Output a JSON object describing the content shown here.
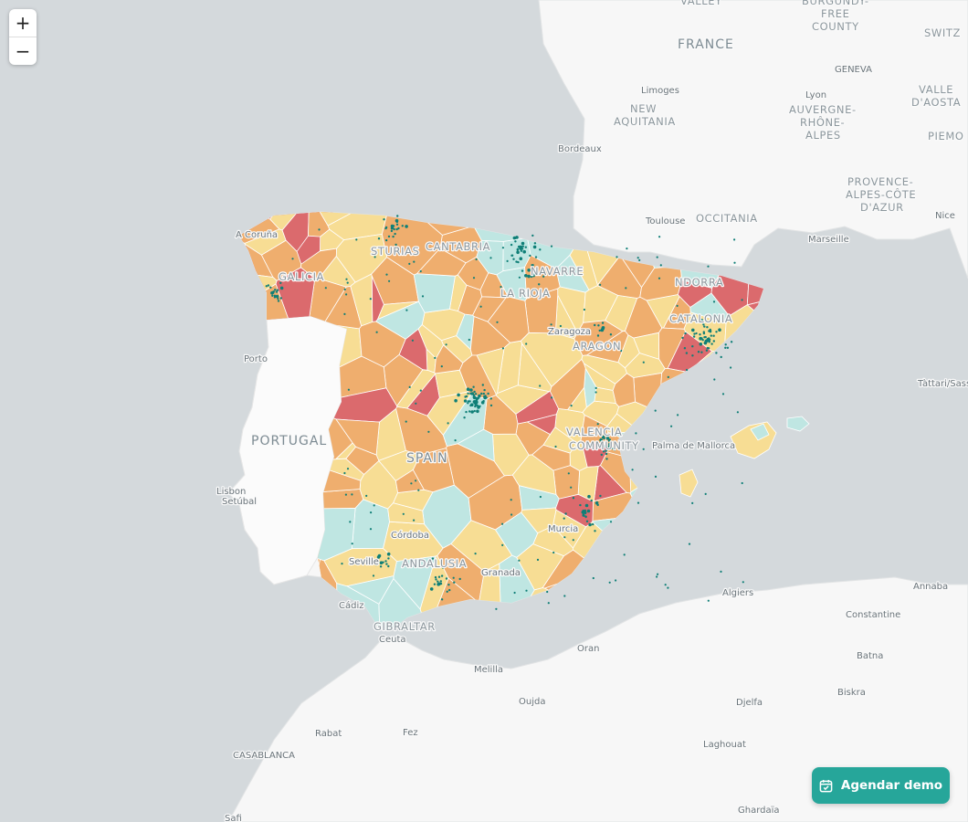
{
  "zoom": {
    "in_label": "+",
    "out_label": "−"
  },
  "cta": {
    "label": "Agendar demo",
    "icon": "calendar-icon",
    "color": "#26a69a"
  },
  "palette": {
    "low": "#bfe6e2",
    "mid_low": "#f7dd94",
    "mid_high": "#efae6e",
    "high": "#db6a6d",
    "points": "#0f7f77"
  },
  "labels": {
    "countries": [
      {
        "id": "france",
        "text": "FRANCE"
      },
      {
        "id": "portugal",
        "text": "PORTUGAL"
      },
      {
        "id": "spain",
        "text": "SPAIN"
      }
    ],
    "regions": [
      {
        "id": "valley",
        "text": "VALLEY"
      },
      {
        "id": "burgundy-1",
        "text": "BURGUNDY-"
      },
      {
        "id": "burgundy-2",
        "text": "FREE"
      },
      {
        "id": "burgundy-3",
        "text": "COUNTY"
      },
      {
        "id": "switz",
        "text": "SWITZ"
      },
      {
        "id": "new-aq-1",
        "text": "NEW"
      },
      {
        "id": "new-aq-2",
        "text": "AQUITANIA"
      },
      {
        "id": "auv-1",
        "text": "AUVERGNE-"
      },
      {
        "id": "auv-2",
        "text": "RHÔNE-"
      },
      {
        "id": "auv-3",
        "text": "ALPES"
      },
      {
        "id": "aosta-1",
        "text": "VALLE"
      },
      {
        "id": "aosta-2",
        "text": "D'AOSTA"
      },
      {
        "id": "piemo",
        "text": "PIEMO"
      },
      {
        "id": "occitania",
        "text": "OCCITANIA"
      },
      {
        "id": "prov-1",
        "text": "PROVENCE-"
      },
      {
        "id": "prov-2",
        "text": "ALPES-CÔTE"
      },
      {
        "id": "prov-3",
        "text": "D'AZUR"
      },
      {
        "id": "andorra",
        "text": "NDORRA"
      },
      {
        "id": "asturias",
        "text": "STURIAS"
      },
      {
        "id": "cantabria",
        "text": "CANTABRIA"
      },
      {
        "id": "navarre",
        "text": "NAVARRE"
      },
      {
        "id": "larioja",
        "text": "LA RIOJA"
      },
      {
        "id": "aragon",
        "text": "ARAGON"
      },
      {
        "id": "catalonia",
        "text": "CATALONIA"
      },
      {
        "id": "valencia-1",
        "text": "VALENCIA"
      },
      {
        "id": "valencia-2",
        "text": "COMMUNITY"
      },
      {
        "id": "andalusia",
        "text": "ANDALUSIA"
      },
      {
        "id": "gibraltar",
        "text": "GIBRALTAR"
      },
      {
        "id": "galicia",
        "text": "GALICIA"
      }
    ],
    "cities": [
      {
        "id": "geneva",
        "text": "GENEVA"
      },
      {
        "id": "limoges",
        "text": "Limoges"
      },
      {
        "id": "lyon",
        "text": "Lyon"
      },
      {
        "id": "bordeaux",
        "text": "Bordeaux"
      },
      {
        "id": "toulouse",
        "text": "Toulouse"
      },
      {
        "id": "marseille",
        "text": "Marseille"
      },
      {
        "id": "nice",
        "text": "Nice"
      },
      {
        "id": "acoruna",
        "text": "A Coruña"
      },
      {
        "id": "porto",
        "text": "Porto"
      },
      {
        "id": "zaragoza",
        "text": "Zaragoza"
      },
      {
        "id": "tattari",
        "text": "Tàttari/Sass"
      },
      {
        "id": "palma",
        "text": "Palma de Mallorca"
      },
      {
        "id": "lisbon",
        "text": "Lisbon"
      },
      {
        "id": "setubal",
        "text": "Setúbal"
      },
      {
        "id": "cordoba",
        "text": "Córdoba"
      },
      {
        "id": "murcia",
        "text": "Murcia"
      },
      {
        "id": "sevilla",
        "text": "Seville"
      },
      {
        "id": "granada",
        "text": "Granada"
      },
      {
        "id": "cadiz",
        "text": "Cádiz"
      },
      {
        "id": "ceuta",
        "text": "Ceuta"
      },
      {
        "id": "algiers",
        "text": "Algiers"
      },
      {
        "id": "annaba",
        "text": "Annaba"
      },
      {
        "id": "constantine",
        "text": "Constantine"
      },
      {
        "id": "oran",
        "text": "Oran"
      },
      {
        "id": "melilla",
        "text": "Melilla"
      },
      {
        "id": "batna",
        "text": "Batna"
      },
      {
        "id": "oujda",
        "text": "Oujda"
      },
      {
        "id": "djelfa",
        "text": "Djelfa"
      },
      {
        "id": "biskra",
        "text": "Biskra"
      },
      {
        "id": "rabat",
        "text": "Rabat"
      },
      {
        "id": "fez",
        "text": "Fez"
      },
      {
        "id": "casablanca",
        "text": "CASABLANCA"
      },
      {
        "id": "laghouat",
        "text": "Laghouat"
      },
      {
        "id": "ghardaia",
        "text": "Ghardaïa"
      },
      {
        "id": "safi",
        "text": "Safi"
      }
    ]
  }
}
